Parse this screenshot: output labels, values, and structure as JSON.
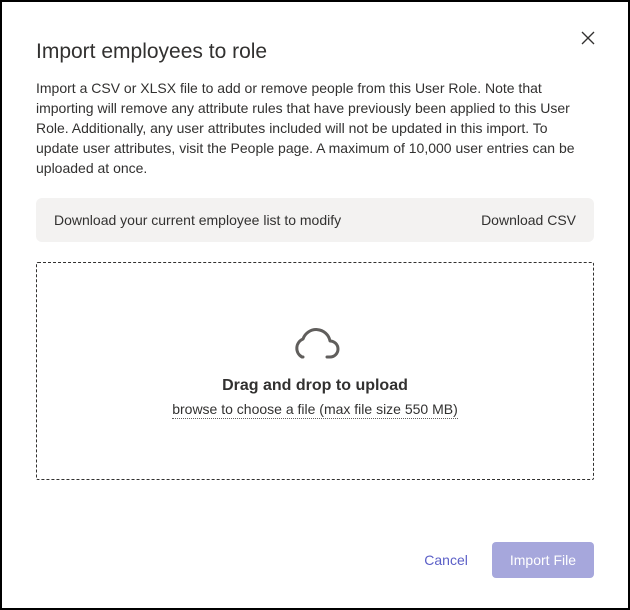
{
  "dialog": {
    "title": "Import employees to role",
    "description": "Import a CSV or XLSX file to add or remove people from this User Role. Note that importing will remove any attribute rules that have previously been applied to this User Role. Additionally, any user attributes included will not be updated in this import. To update user attributes, visit the People page. A maximum of 10,000 user entries can be uploaded at once."
  },
  "downloadBar": {
    "text": "Download your current employee list to modify",
    "link": "Download CSV"
  },
  "dropzone": {
    "title": "Drag and drop to upload",
    "browse": "browse to choose a file (max file size 550 MB)"
  },
  "footer": {
    "cancel": "Cancel",
    "import": "Import File"
  }
}
